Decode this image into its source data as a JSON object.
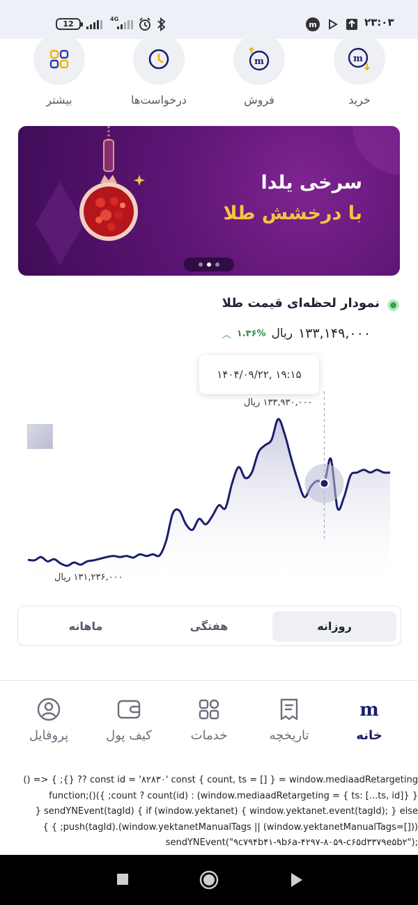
{
  "status_bar": {
    "time": "۲۳:۰۳",
    "battery": "12",
    "network": "4G"
  },
  "quick_actions": [
    {
      "label": "بیشتر",
      "icon": "apps-grid-icon"
    },
    {
      "label": "درخواست‌ها",
      "icon": "clock-icon"
    },
    {
      "label": "فروش",
      "icon": "sell-icon"
    },
    {
      "label": "خرید",
      "icon": "buy-icon"
    }
  ],
  "banner": {
    "line1": "سرخی یلدا",
    "line2": "با درخشش طلا",
    "slide_count": 3,
    "active_slide": 2
  },
  "chart_section": {
    "title": "نمودار لحظه‌ای قیمت طلا",
    "price": "۱۳۳,۱۴۹,۰۰۰",
    "unit": "ریال",
    "change": "۱.۳۶%",
    "tooltip_datetime": "۱۴۰۴/۰۹/۲۲, ۱۹:۱۵",
    "max_label": "۱۳۳,۹۳۰,۰۰۰ ریال",
    "min_label": "۱۳۱,۲۳۶,۰۰۰ ریال"
  },
  "chart_data": {
    "type": "area",
    "x_axis": "time",
    "y_unit": "ریال",
    "series": [
      {
        "values": [
          131350000,
          131340000,
          131400000,
          131320000,
          131360000,
          131280000,
          131240000,
          131300000,
          131260000,
          131320000,
          131340000,
          131370000,
          131400000,
          131420000,
          131400000,
          131420000,
          131390000,
          131450000,
          131420000,
          131450000,
          131430000,
          131700000,
          132200000,
          132250000,
          132000000,
          131900000,
          132100000,
          132000000,
          132150000,
          132350000,
          132300000,
          132750000,
          133050000,
          132850000,
          132950000,
          133320000,
          133450000,
          133550000,
          133930000,
          133650000,
          133200000,
          132800000,
          132500000,
          132700000,
          132800000,
          132750000,
          133200000,
          132300000,
          132500000,
          132900000,
          132950000,
          133000000,
          132950000,
          133000000,
          132950000,
          132950000
        ],
        "max": 133930000,
        "min": 131236000,
        "highlighted_index": 45
      }
    ]
  },
  "period_tabs": [
    {
      "label": "روزانه",
      "active": true
    },
    {
      "label": "هفتگی",
      "active": false
    },
    {
      "label": "ماهانه",
      "active": false
    }
  ],
  "bottom_nav": [
    {
      "label": "خانه",
      "icon": "home-logo-icon",
      "active": true
    },
    {
      "label": "تاریخچه",
      "icon": "history-icon",
      "active": false
    },
    {
      "label": "خدمات",
      "icon": "services-grid-icon",
      "active": false
    },
    {
      "label": "کیف پول",
      "icon": "wallet-icon",
      "active": false
    },
    {
      "label": "پروفایل",
      "icon": "profile-icon",
      "active": false
    }
  ],
  "script_lines": [
    "const id = '۸۲۸۳۰' const { count, ts = [] } = window.mediaadRetargeting ?? {}; } <= ()",
    "function;()({ ;count ? count(id) : (window.mediaadRetargeting = { ts: [...ts, id]} }",
    "sendYNEvent(tagId) { if (window.yektanet) { window.yektanet.event(tagId); } else {",
    "(window.yektanetManualTags || (window.yektanetManualTags=[])).push(tagId); } }",
    ";sendYNEvent(\"۹c۷۹۴b۴۱-۹b۶a-۴۲۹۷-۸۰۵۹-c۶۵d۳۳۷۹e۵b۲\")"
  ],
  "colors": {
    "accent": "#1b1e6b",
    "banner": "#5c1574",
    "gold": "#f5c542",
    "positive": "#2f8f3f"
  }
}
